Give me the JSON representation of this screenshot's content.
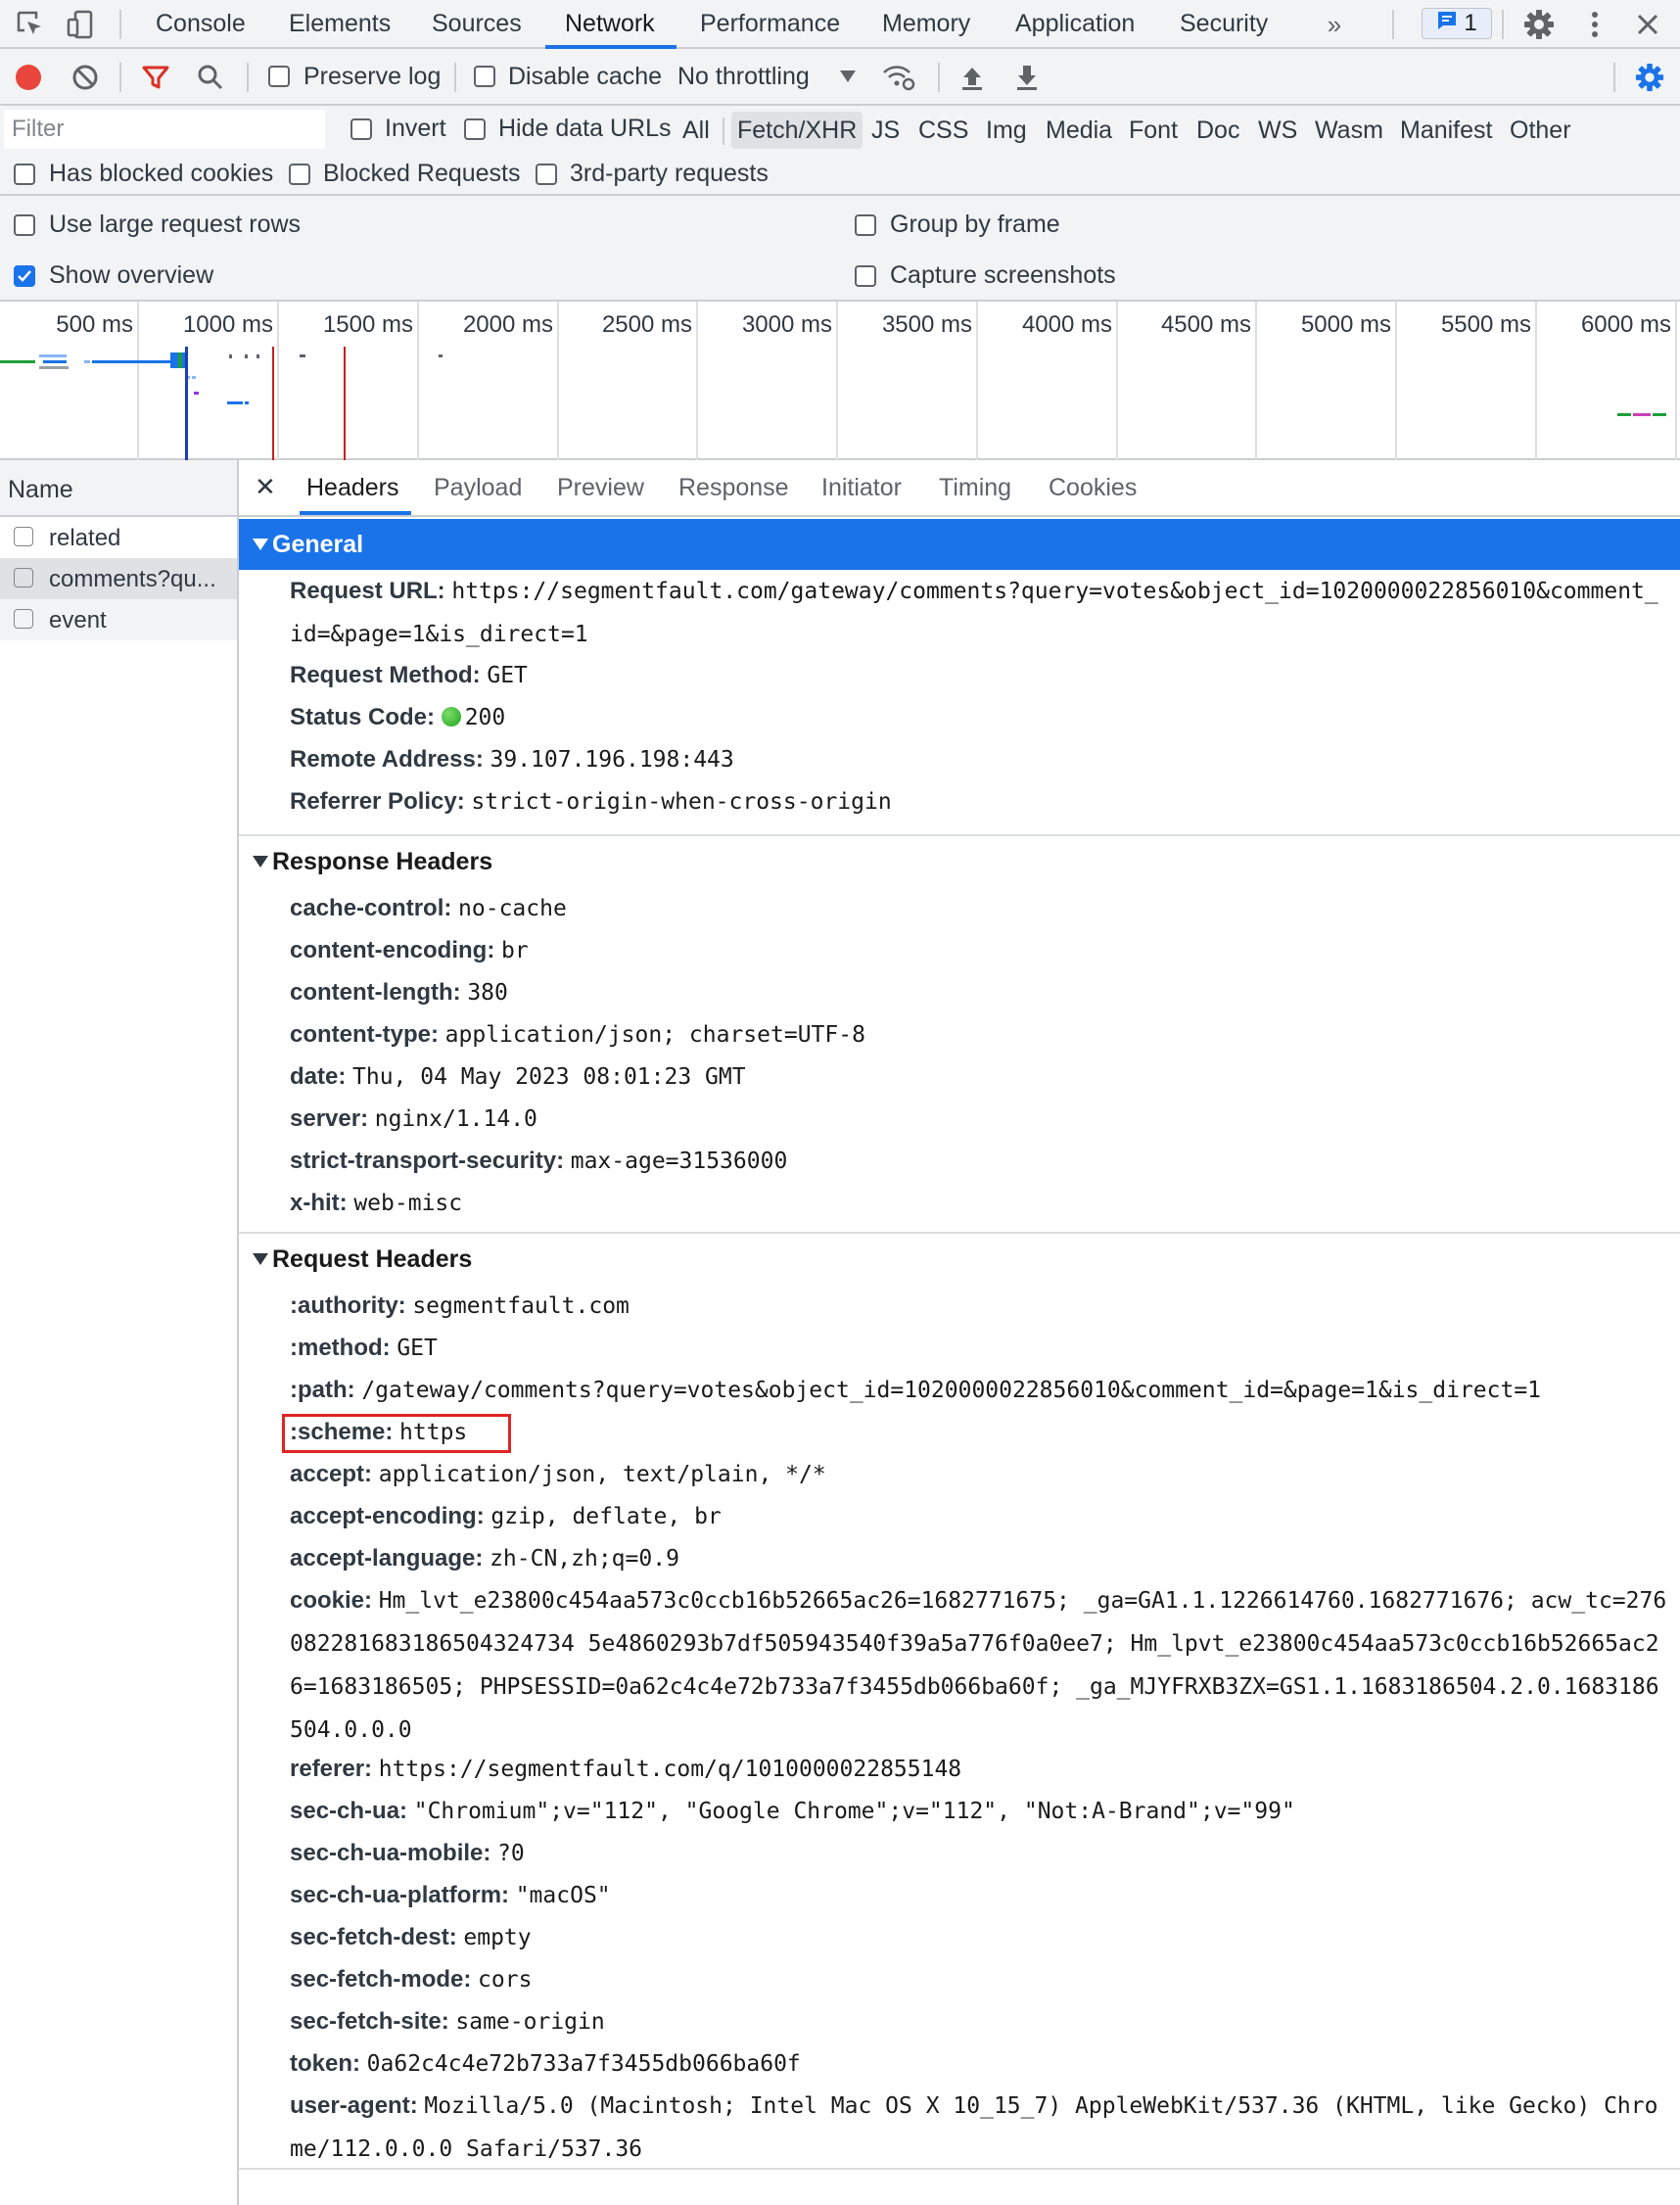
{
  "main_tabs": [
    "Console",
    "Elements",
    "Sources",
    "Network",
    "Performance",
    "Memory",
    "Application",
    "Security"
  ],
  "active_main_tab": "Network",
  "issues_count": "1",
  "toolbar": {
    "preserve_log": "Preserve log",
    "disable_cache": "Disable cache",
    "throttling": "No throttling"
  },
  "filter": {
    "placeholder": "Filter",
    "invert": "Invert",
    "hide_data_urls": "Hide data URLs",
    "types": [
      "All",
      "Fetch/XHR",
      "JS",
      "CSS",
      "Img",
      "Media",
      "Font",
      "Doc",
      "WS",
      "Wasm",
      "Manifest",
      "Other"
    ],
    "selected_type": "Fetch/XHR",
    "has_blocked_cookies": "Has blocked cookies",
    "blocked_requests": "Blocked Requests",
    "third_party": "3rd-party requests"
  },
  "settings": {
    "use_large_rows": "Use large request rows",
    "show_overview": "Show overview",
    "group_by_frame": "Group by frame",
    "capture_screenshots": "Capture screenshots"
  },
  "overview": {
    "ticks": [
      "500 ms",
      "1000 ms",
      "1500 ms",
      "2000 ms",
      "2500 ms",
      "3000 ms",
      "3500 ms",
      "4000 ms",
      "4500 ms",
      "5000 ms",
      "5500 ms",
      "6000 ms"
    ]
  },
  "name_column": {
    "header": "Name",
    "requests": [
      "related",
      "comments?qu...",
      "event"
    ]
  },
  "detail_tabs": [
    "Headers",
    "Payload",
    "Preview",
    "Response",
    "Initiator",
    "Timing",
    "Cookies"
  ],
  "active_detail_tab": "Headers",
  "general": {
    "title": "General",
    "rows": [
      {
        "key": "Request URL:",
        "value": "https://segmentfault.com/gateway/comments?query=votes&object_id=1020000022856010&comment_id=&page=1&is_direct=1"
      },
      {
        "key": "Request Method:",
        "value": "GET"
      },
      {
        "key": "Status Code:",
        "value": "200"
      },
      {
        "key": "Remote Address:",
        "value": "39.107.196.198:443"
      },
      {
        "key": "Referrer Policy:",
        "value": "strict-origin-when-cross-origin"
      }
    ]
  },
  "response_headers": {
    "title": "Response Headers",
    "rows": [
      {
        "key": "cache-control:",
        "value": "no-cache"
      },
      {
        "key": "content-encoding:",
        "value": "br"
      },
      {
        "key": "content-length:",
        "value": "380"
      },
      {
        "key": "content-type:",
        "value": "application/json; charset=UTF-8"
      },
      {
        "key": "date:",
        "value": "Thu, 04 May 2023 08:01:23 GMT"
      },
      {
        "key": "server:",
        "value": "nginx/1.14.0"
      },
      {
        "key": "strict-transport-security:",
        "value": "max-age=31536000"
      },
      {
        "key": "x-hit:",
        "value": "web-misc"
      }
    ]
  },
  "request_headers": {
    "title": "Request Headers",
    "rows": [
      {
        "key": ":authority:",
        "value": "segmentfault.com"
      },
      {
        "key": ":method:",
        "value": "GET"
      },
      {
        "key": ":path:",
        "value": "/gateway/comments?query=votes&object_id=1020000022856010&comment_id=&page=1&is_direct=1"
      },
      {
        "key": ":scheme:",
        "value": "https"
      },
      {
        "key": "accept:",
        "value": "application/json, text/plain, */*"
      },
      {
        "key": "accept-encoding:",
        "value": "gzip, deflate, br"
      },
      {
        "key": "accept-language:",
        "value": "zh-CN,zh;q=0.9"
      },
      {
        "key": "cookie:",
        "value": "Hm_lvt_e23800c454aa573c0ccb16b52665ac26=1682771675; _ga=GA1.1.1226614760.1682771676; acw_tc=276082281683186504324734 5e4860293b7df505943540f39a5a776f0a0ee7; Hm_lpvt_e23800c454aa573c0ccb16b52665ac26=1683186505; PHPSESSID=0a62c4c4e72b733a7f3455db066ba60f; _ga_MJYFRXB3ZX=GS1.1.1683186504.2.0.1683186504.0.0.0"
      },
      {
        "key": "referer:",
        "value": "https://segmentfault.com/q/1010000022855148"
      },
      {
        "key": "sec-ch-ua:",
        "value": "\"Chromium\";v=\"112\", \"Google Chrome\";v=\"112\", \"Not:A-Brand\";v=\"99\""
      },
      {
        "key": "sec-ch-ua-mobile:",
        "value": "?0"
      },
      {
        "key": "sec-ch-ua-platform:",
        "value": "\"macOS\""
      },
      {
        "key": "sec-fetch-dest:",
        "value": "empty"
      },
      {
        "key": "sec-fetch-mode:",
        "value": "cors"
      },
      {
        "key": "sec-fetch-site:",
        "value": "same-origin"
      },
      {
        "key": "token:",
        "value": "0a62c4c4e72b733a7f3455db066ba60f"
      },
      {
        "key": "user-agent:",
        "value": "Mozilla/5.0 (Macintosh; Intel Mac OS X 10_15_7) AppleWebKit/537.36 (KHTML, like Gecko) Chrome/112.0.0.0 Safari/537.36"
      }
    ]
  },
  "colors": {
    "accent": "#1a73e8",
    "record": "#e8453c",
    "filter_icon": "#d93025",
    "highlight": "#e02424",
    "status_ok": "#1ea51e"
  }
}
